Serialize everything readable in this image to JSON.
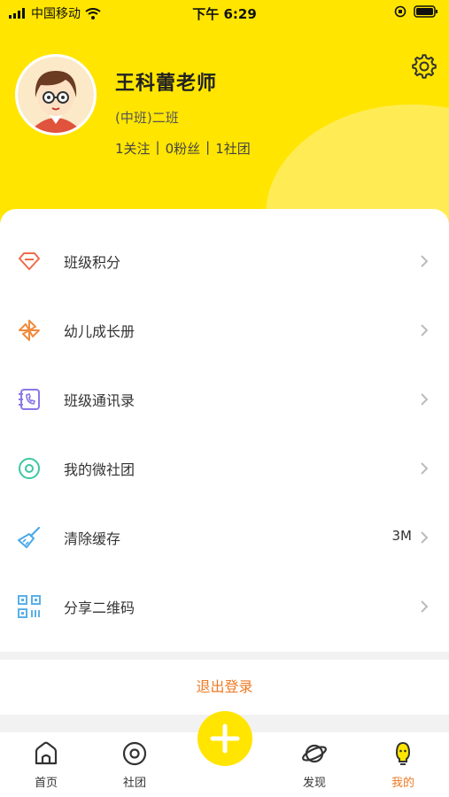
{
  "status_bar": {
    "carrier": "中国移动",
    "time": "下午 6:29"
  },
  "profile": {
    "name": "王科蕾老师",
    "class": "(中班)二班",
    "stats": [
      "1关注",
      "|",
      "0粉丝",
      "|",
      "1社团"
    ]
  },
  "menu": [
    {
      "label": "班级积分",
      "icon": "diamond-icon",
      "color": "#f06a4a",
      "value": ""
    },
    {
      "label": "幼儿成长册",
      "icon": "pinwheel-icon",
      "color": "#f28b3c",
      "value": ""
    },
    {
      "label": "班级通讯录",
      "icon": "contacts-phone-icon",
      "color": "#8a78e8",
      "value": ""
    },
    {
      "label": "我的微社团",
      "icon": "circle-target-icon",
      "color": "#3cc8a0",
      "value": ""
    },
    {
      "label": "清除缓存",
      "icon": "broom-icon",
      "color": "#4aa8e8",
      "value": "3M"
    },
    {
      "label": "分享二维码",
      "icon": "qr-code-icon",
      "color": "#5ab0e8",
      "value": ""
    }
  ],
  "logout_label": "退出登录",
  "tabs": [
    {
      "label": "首页",
      "icon": "home-icon"
    },
    {
      "label": "社团",
      "icon": "club-circle-icon"
    },
    {
      "label": "发现",
      "icon": "planet-icon"
    },
    {
      "label": "我的",
      "icon": "bulb-face-icon",
      "active": true
    }
  ],
  "colors": {
    "brand_yellow": "#ffe500",
    "accent_orange": "#ee7a24"
  }
}
